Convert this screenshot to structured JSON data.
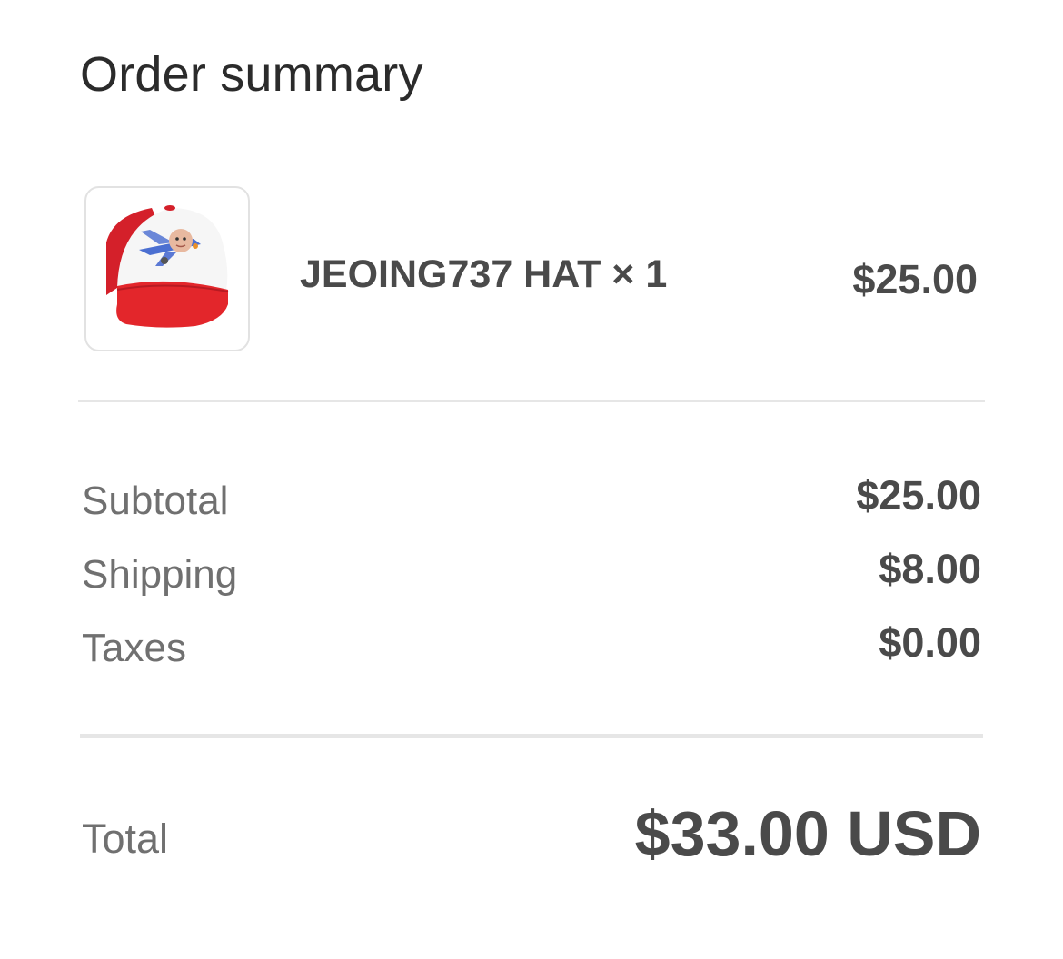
{
  "header": {
    "title": "Order summary"
  },
  "line_items": [
    {
      "name": "JEOING737 HAT × 1",
      "price": "$25.00",
      "image_icon": "cap-product-thumbnail"
    }
  ],
  "summary": {
    "subtotal_label": "Subtotal",
    "subtotal_value": "$25.00",
    "shipping_label": "Shipping",
    "shipping_value": "$8.00",
    "taxes_label": "Taxes",
    "taxes_value": "$0.00"
  },
  "total": {
    "label": "Total",
    "value": "$33.00 USD"
  },
  "colors": {
    "title_text": "#2b2b2b",
    "muted_text": "#707070",
    "value_text": "#4a4a4a",
    "divider": "#e6e6e6",
    "cap_red": "#e3262b"
  }
}
